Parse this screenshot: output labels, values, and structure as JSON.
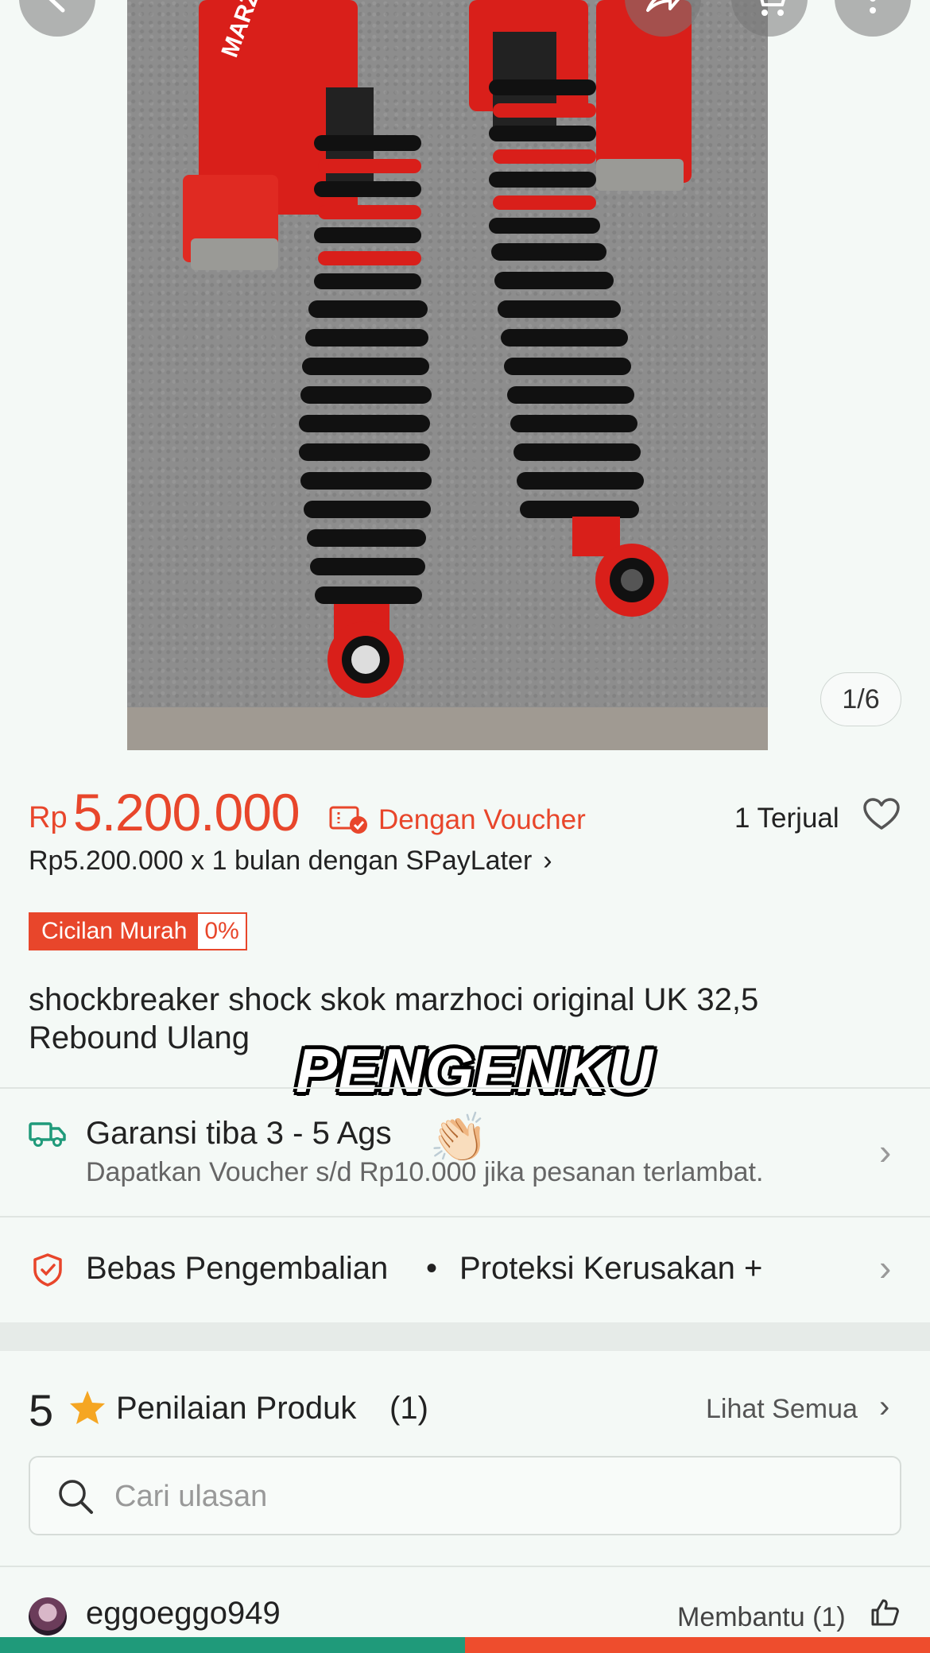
{
  "gallery": {
    "counter": "1/6",
    "photo_text": "MARZOCCHI"
  },
  "price": {
    "currency": "Rp",
    "amount": "5.200.000",
    "voucher_label": "Dengan Voucher",
    "sold_label": "1 Terjual",
    "paylater": "Rp5.200.000 x 1 bulan dengan SPayLater",
    "installment_badge": "Cicilan Murah",
    "installment_rate": "0%"
  },
  "product": {
    "title": "shockbreaker shock skok marzhoci original UK 32,5 Rebound Ulang"
  },
  "overlay": {
    "watermark": "PENGENKU",
    "emoji": "👏🏻"
  },
  "shipping": {
    "title": "Garansi tiba 3 - 5 Ags",
    "subtitle": "Dapatkan Voucher s/d Rp10.000 jika pesanan terlambat."
  },
  "protection": {
    "returns": "Bebas Pengembalian",
    "separator": "•",
    "damage": "Proteksi Kerusakan +"
  },
  "reviews": {
    "score": "5",
    "label": "Penilaian Produk",
    "count": "(1)",
    "see_all": "Lihat Semua",
    "search_placeholder": "Cari ulasan",
    "reviewer": "eggoeggo949",
    "helpful": "Membantu (1)"
  },
  "colors": {
    "accent": "#e8462b",
    "teal": "#1f9a7a"
  },
  "icons": [
    "back-icon",
    "share-icon",
    "cart-icon",
    "more-icon",
    "voucher-icon",
    "heart-icon",
    "truck-icon",
    "shield-icon",
    "star-icon",
    "search-icon",
    "thumbs-up-icon",
    "chevron-right-icon"
  ]
}
